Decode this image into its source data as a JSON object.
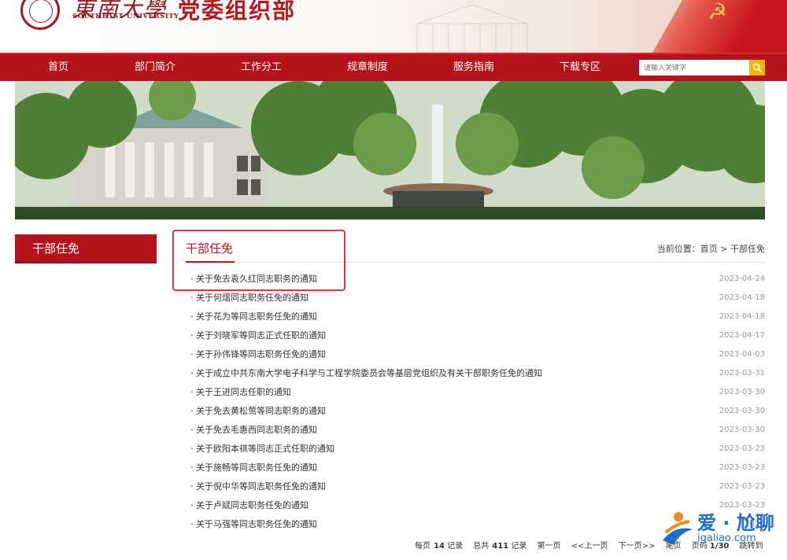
{
  "header": {
    "university_cn": "東南大學",
    "university_en": "SOUTHEAST UNIVERSITY",
    "department": "党委组织部"
  },
  "nav": {
    "items": [
      "首页",
      "部门简介",
      "工作分工",
      "规章制度",
      "服务指南",
      "下载专区"
    ],
    "search_placeholder": "请输入关键字"
  },
  "sidebar": {
    "active_label": "干部任免"
  },
  "content": {
    "title": "干部任免",
    "breadcrumb": "当前位置：首页 > 干部任免",
    "items": [
      {
        "title": "· 关于免去袁久红同志职务的通知",
        "date": "2023-04-24"
      },
      {
        "title": "· 关于何熠同志职务任免的通知",
        "date": "2023-04-18"
      },
      {
        "title": "· 关于花为等同志职务任免的通知",
        "date": "2023-04-18"
      },
      {
        "title": "· 关于刘晓军等同志正式任职的通知",
        "date": "2023-04-17"
      },
      {
        "title": "· 关于孙伟锋等同志职务任免的通知",
        "date": "2023-04-03"
      },
      {
        "title": "· 关于成立中共东南大学电子科学与工程学院委员会等基层党组织及有关干部职务任免的通知",
        "date": "2023-03-31"
      },
      {
        "title": "· 关于王进同志任职的通知",
        "date": "2023-03-30"
      },
      {
        "title": "· 关于免去黄松莺等同志职务的通知",
        "date": "2023-03-30"
      },
      {
        "title": "· 关于免去毛惠西同志职务的通知",
        "date": "2023-03-30"
      },
      {
        "title": "· 关于欧阳本祺等同志正式任职的通知",
        "date": "2023-03-23"
      },
      {
        "title": "· 关于施畅等同志职务任免的通知",
        "date": "2023-03-23"
      },
      {
        "title": "· 关于倪中华等同志职务任免的通知",
        "date": "2023-03-23"
      },
      {
        "title": "· 关于卢斌同志职务任免的通知",
        "date": "2023-03-23"
      },
      {
        "title": "· 关于马强等同志职务任免的通知",
        "date": "2022"
      }
    ]
  },
  "pager": {
    "per_page_label": "每页",
    "per_page": "14",
    "records_unit": "记录",
    "total_label": "总共",
    "total": "411",
    "first": "第一页",
    "prev": "<<上一页",
    "next": "下一页>>",
    "last": "尾页",
    "page_label": "页码",
    "page": "1/30",
    "goto": "跳转到"
  },
  "watermark": {
    "text": "爱 · 尬聊",
    "site": "igaliao.com"
  },
  "colors": {
    "brand_red": "#b3131a",
    "highlight_red": "#d8393b",
    "search_button": "#f2b500"
  }
}
